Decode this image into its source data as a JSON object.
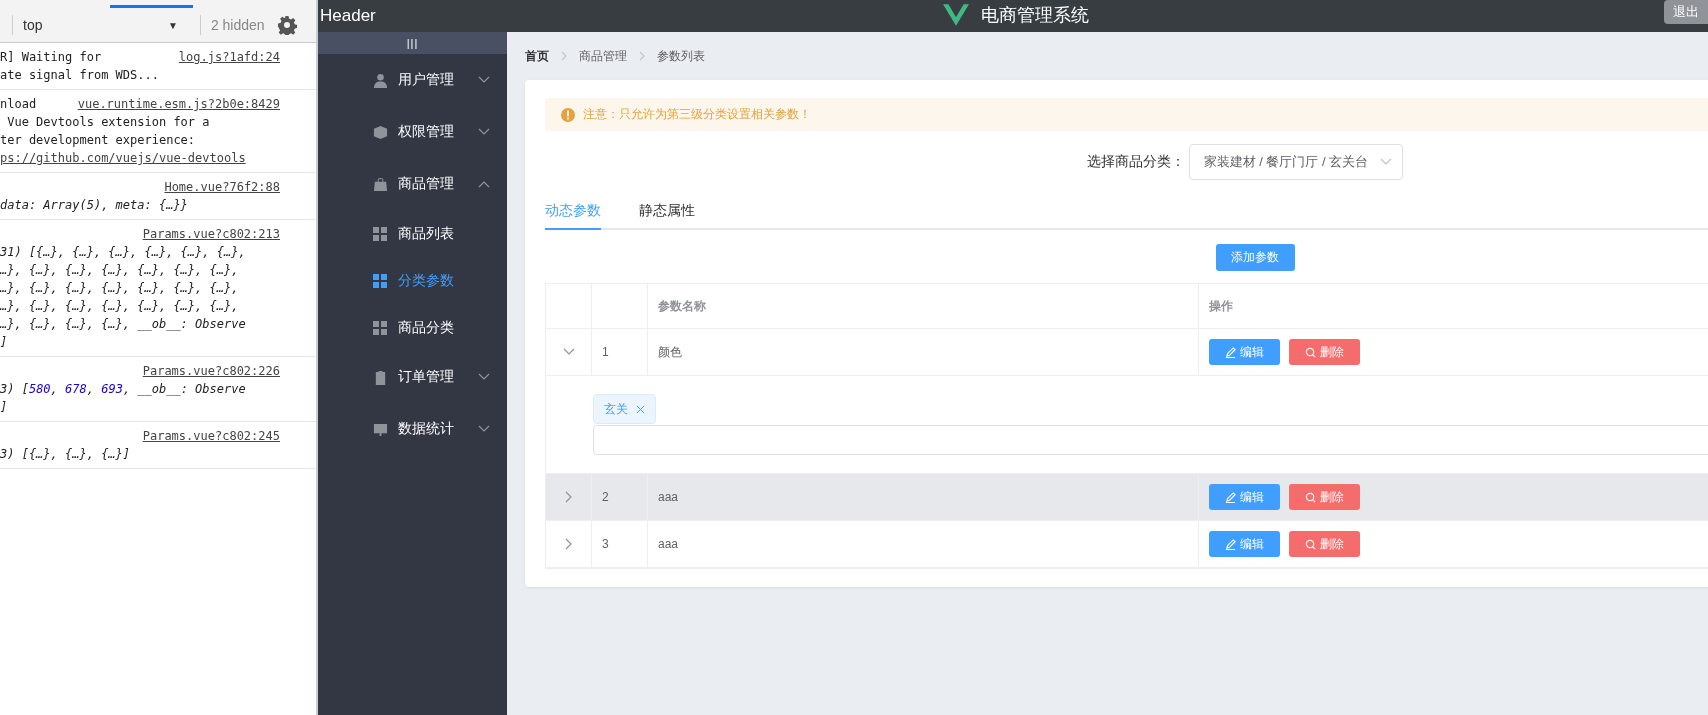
{
  "devtools": {
    "context": "top",
    "caret": "▼",
    "hidden": "2 hidden",
    "logs": [
      {
        "kind": "inline",
        "source": "log.js?1afd:24",
        "lines": [
          [
            {
              "kind": "plain",
              "text": "R] Waiting for"
            }
          ],
          [
            {
              "kind": "plain",
              "text": "ate signal from WDS..."
            }
          ]
        ]
      },
      {
        "kind": "inline",
        "source": "vue.runtime.esm.js?2b0e:8429",
        "lines": [
          [
            {
              "kind": "plain",
              "text": "nload"
            }
          ],
          [
            {
              "kind": "plain",
              "text": " Vue Devtools extension for a"
            }
          ],
          [
            {
              "kind": "plain",
              "text": "ter development experience:"
            }
          ],
          [
            {
              "kind": "link",
              "text": "ps://github.com/vuejs/vue-devtools"
            }
          ]
        ]
      },
      {
        "kind": "block",
        "source": "Home.vue?76f2:88",
        "lines": [
          [
            {
              "kind": "italic",
              "text": "data: Array(5), meta: {…}}"
            }
          ]
        ]
      },
      {
        "kind": "block",
        "source": "Params.vue?c802:213",
        "lines": [
          [
            {
              "kind": "italic",
              "text": "31) [{…}, {…}, {…}, {…}, {…}, {…},"
            }
          ],
          [
            {
              "kind": "italic",
              "text": "…}, {…}, {…}, {…}, {…}, {…}, {…},"
            }
          ],
          [
            {
              "kind": "italic",
              "text": "…}, {…}, {…}, {…}, {…}, {…}, {…},"
            }
          ],
          [
            {
              "kind": "italic",
              "text": "…}, {…}, {…}, {…}, {…}, {…}, {…},"
            }
          ],
          [
            {
              "kind": "italic",
              "text": "…}, {…}, {…}, {…}, __ob__: Observe"
            }
          ],
          [
            {
              "kind": "italic",
              "text": "]"
            }
          ]
        ]
      },
      {
        "kind": "block",
        "source": "Params.vue?c802:226",
        "lines": [
          [
            {
              "kind": "italic",
              "text": "3) ["
            },
            {
              "kind": "number",
              "text": "580"
            },
            {
              "kind": "italic",
              "text": ", "
            },
            {
              "kind": "number",
              "text": "678"
            },
            {
              "kind": "italic",
              "text": ", "
            },
            {
              "kind": "number",
              "text": "693"
            },
            {
              "kind": "italic",
              "text": ", __ob__: Observe"
            }
          ],
          [
            {
              "kind": "italic",
              "text": "]"
            }
          ]
        ]
      },
      {
        "kind": "block",
        "source": "Params.vue?c802:245",
        "lines": [
          [
            {
              "kind": "italic",
              "text": "3) [{…}, {…}, {…}]"
            }
          ]
        ]
      }
    ]
  },
  "header": {
    "label": "Header",
    "title": "电商管理系统",
    "logout": "退出"
  },
  "sidebar": {
    "toggle": "|||",
    "items": [
      {
        "label": "用户管理",
        "kind": "user",
        "expanded": false
      },
      {
        "label": "权限管理",
        "kind": "box",
        "expanded": false
      },
      {
        "label": "商品管理",
        "kind": "bag",
        "expanded": true,
        "children": [
          {
            "label": "商品列表",
            "selected": false
          },
          {
            "label": "分类参数",
            "selected": true
          },
          {
            "label": "商品分类",
            "selected": false
          }
        ]
      },
      {
        "label": "订单管理",
        "kind": "order",
        "expanded": false
      },
      {
        "label": "数据统计",
        "kind": "chart",
        "expanded": false
      }
    ]
  },
  "breadcrumb": [
    "首页",
    "商品管理",
    "参数列表"
  ],
  "alert": "注意：只允许为第三级分类设置相关参数！",
  "category": {
    "label": "选择商品分类：",
    "value": "家装建材 / 餐厅门厅 / 玄关台"
  },
  "tabs": [
    {
      "label": "动态参数",
      "selected": true
    },
    {
      "label": "静态属性",
      "selected": false
    }
  ],
  "add_button": "添加参数",
  "table": {
    "columns": [
      "参数名称",
      "操作"
    ],
    "rows": [
      {
        "index": "1",
        "name": "颜色",
        "expanded": true,
        "hovered": false,
        "tags": [
          "玄关"
        ],
        "actions": [
          "编辑",
          "删除"
        ]
      },
      {
        "index": "2",
        "name": "aaa",
        "expanded": false,
        "hovered": true,
        "actions": [
          "编辑",
          "删除"
        ]
      },
      {
        "index": "3",
        "name": "aaa",
        "expanded": false,
        "hovered": false,
        "actions": [
          "编辑",
          "删除"
        ]
      }
    ]
  }
}
